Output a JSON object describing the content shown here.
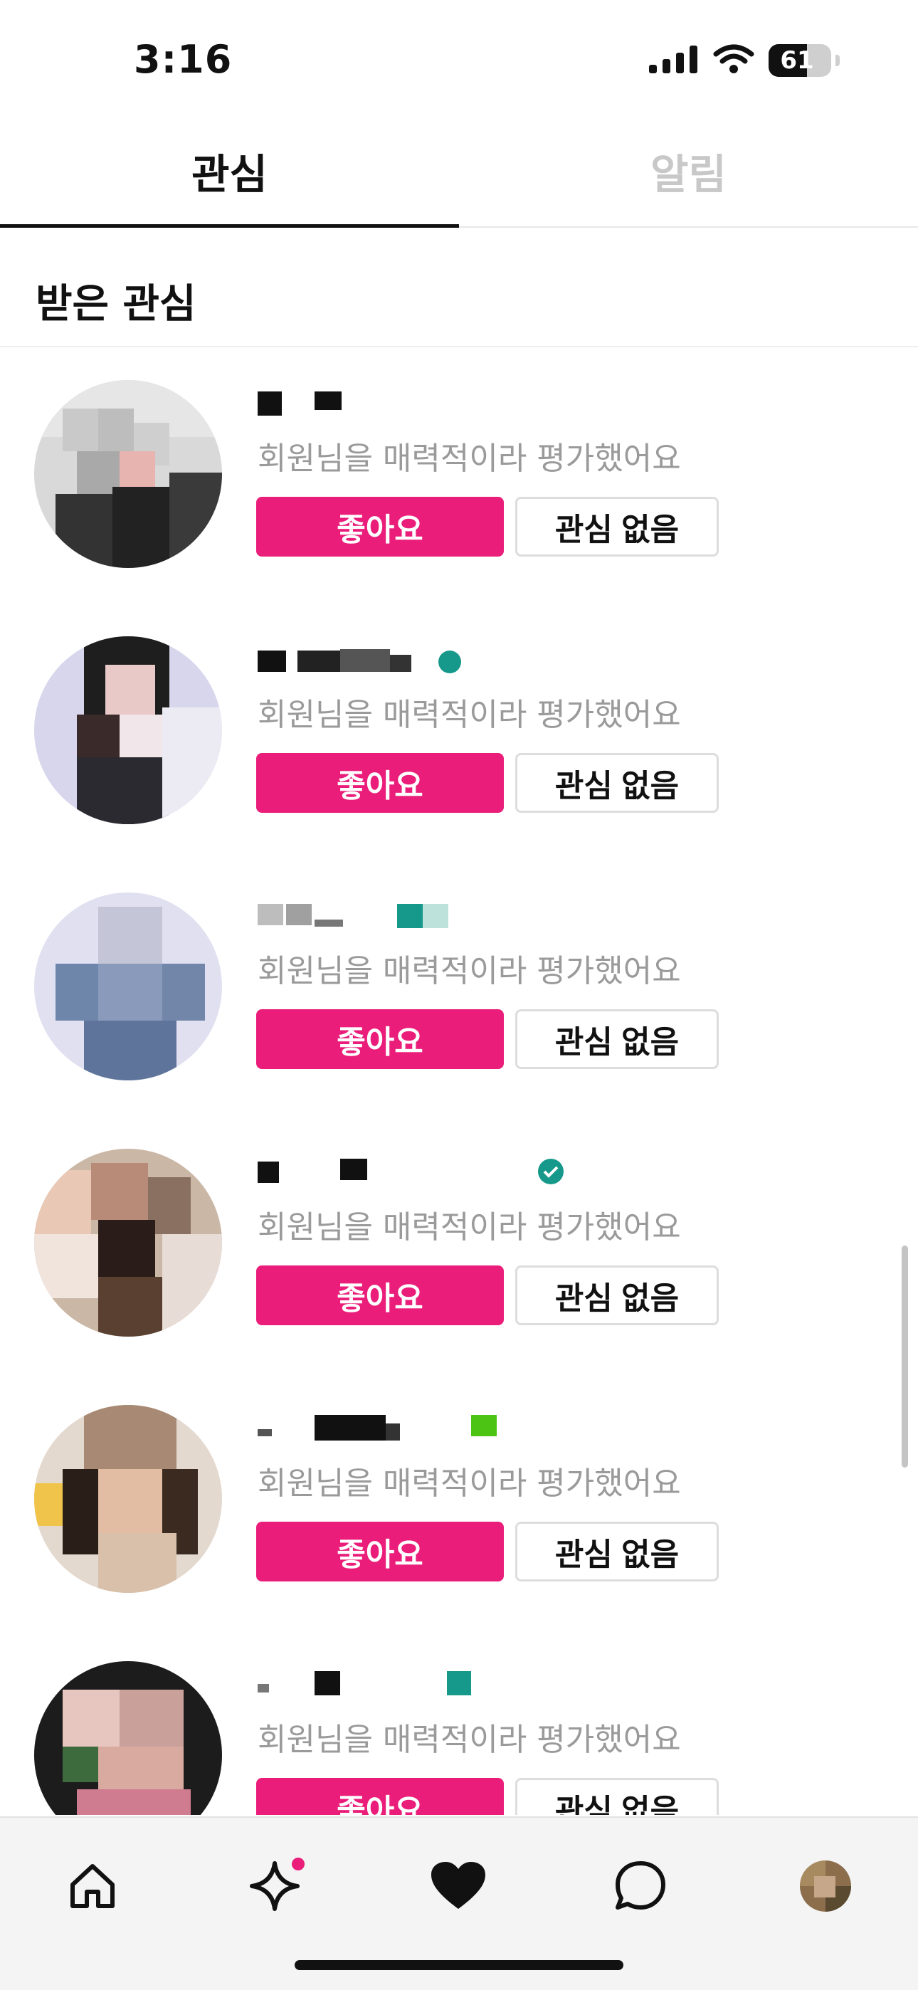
{
  "status_bar": {
    "time": "3:16",
    "battery_percent": 61,
    "battery_label": "61"
  },
  "tabs": [
    {
      "label": "관심",
      "active": true
    },
    {
      "label": "알림",
      "active": false
    }
  ],
  "section": {
    "title": "받은 관심"
  },
  "items": [
    {
      "description": "회원님을 매력적이라 평가했어요",
      "like_label": "좋아요",
      "pass_label": "관심 없음"
    },
    {
      "description": "회원님을 매력적이라 평가했어요",
      "like_label": "좋아요",
      "pass_label": "관심 없음"
    },
    {
      "description": "회원님을 매력적이라 평가했어요",
      "like_label": "좋아요",
      "pass_label": "관심 없음"
    },
    {
      "description": "회원님을 매력적이라 평가했어요",
      "like_label": "좋아요",
      "pass_label": "관심 없음"
    },
    {
      "description": "회원님을 매력적이라 평가했어요",
      "like_label": "좋아요",
      "pass_label": "관심 없음"
    },
    {
      "description": "회원님을 매력적이라 평가했어요",
      "like_label": "좋아요",
      "pass_label": "관심 없음"
    }
  ],
  "bottom_nav": [
    {
      "icon": "home-icon"
    },
    {
      "icon": "sparkle-icon",
      "badge": true
    },
    {
      "icon": "heart-icon"
    },
    {
      "icon": "chat-icon"
    },
    {
      "icon": "profile-avatar"
    }
  ],
  "colors": {
    "accent": "#ea1e7a",
    "verified": "#16998a",
    "muted": "#9a9a9a",
    "inactive_tab": "#c8c8c8"
  }
}
